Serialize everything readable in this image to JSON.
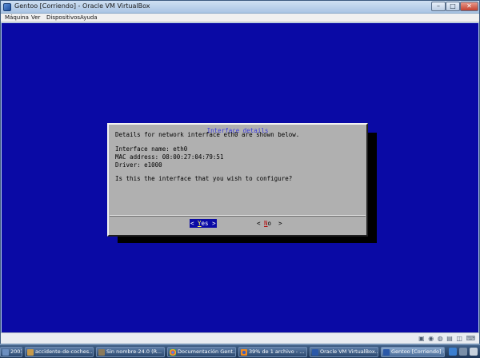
{
  "window": {
    "title": "Gentoo [Corriendo] - Oracle VM VirtualBox"
  },
  "menu": {
    "items": [
      "Máquina",
      "Ver",
      "Dispositivos",
      "Ayuda"
    ]
  },
  "dialog": {
    "title": "Interface details",
    "intro": "Details for network interface eth0 are shown below.",
    "interface_name": "Interface name: eth0",
    "mac_address": "MAC address: 08:00:27:04:79:51",
    "driver": "Driver: e1000",
    "question": "Is this the interface that you wish to configure?",
    "yes_left": "< ",
    "yes_hot": "Y",
    "yes_rest": "es >",
    "no_left": "< ",
    "no_hot": "N",
    "no_rest": "o  >"
  },
  "taskbar": {
    "items": [
      {
        "label": "2003...",
        "icon": "app-icon"
      },
      {
        "label": "accidente-de-coches...",
        "icon": "image-icon"
      },
      {
        "label": "Sin nombre-24.0 (R...",
        "icon": "gimp-icon"
      },
      {
        "label": "Documentación Gent...",
        "icon": "chrome-icon"
      },
      {
        "label": "39% de 1 archivo - ...",
        "icon": "firefox-icon"
      },
      {
        "label": "Oracle VM VirtualBox...",
        "icon": "virtualbox-icon"
      },
      {
        "label": "Gentoo [Corriendo] -...",
        "icon": "virtualbox-icon"
      }
    ]
  },
  "colors": {
    "vm_background": "#0a0aa5",
    "dialog_background": "#b0b0b0",
    "title_blue": "#3a3ae0"
  }
}
